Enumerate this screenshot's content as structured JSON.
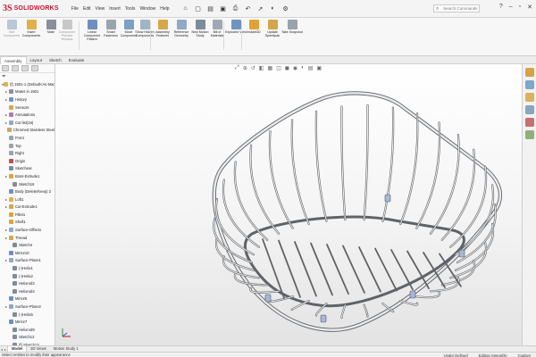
{
  "app": {
    "logo_mark": "3S",
    "logo_text": "SOLIDWORKS"
  },
  "menu": [
    "File",
    "Edit",
    "View",
    "Insert",
    "Tools",
    "Window",
    "Help"
  ],
  "quick_access": [
    {
      "icon": "home-icon",
      "glyph": "⌂"
    },
    {
      "icon": "new-document-icon",
      "glyph": "▢"
    },
    {
      "icon": "open-folder-icon",
      "glyph": "▤"
    },
    {
      "icon": "save-icon",
      "glyph": "▣"
    },
    {
      "icon": "print-icon",
      "glyph": "⎙"
    },
    {
      "icon": "undo-icon",
      "glyph": "↶"
    },
    {
      "icon": "select-pointer-icon",
      "glyph": "➚"
    },
    {
      "icon": "rebuild-icon",
      "glyph": "◐"
    },
    {
      "icon": "options-gear-icon",
      "glyph": "⚙"
    }
  ],
  "search": {
    "placeholder": "Search Commands"
  },
  "ribbon": [
    {
      "label": "Edit Component",
      "color": "#b9c7d6",
      "dim": true
    },
    {
      "label": "Insert Components",
      "color": "#e2b04a",
      "dim": false
    },
    {
      "label": "Mate",
      "color": "#8a8f99",
      "dim": false
    },
    {
      "label": "Component Preview Window",
      "color": "#c8c8c8",
      "dim": true
    },
    {
      "label": "Linear Component Pattern",
      "color": "#6f8fbf",
      "dim": false
    },
    {
      "label": "Smart Fasteners",
      "color": "#9aa4ad",
      "dim": false
    },
    {
      "label": "Move Component",
      "color": "#7c9fc4",
      "dim": false
    },
    {
      "label": "Show Hidden Components",
      "color": "#a0b4c6",
      "dim": false
    },
    {
      "label": "Assembly Features",
      "color": "#d7a64c",
      "dim": false
    },
    {
      "label": "Reference Geometry",
      "color": "#8fa9c7",
      "dim": false
    },
    {
      "label": "New Motion Study",
      "color": "#7f8c99",
      "dim": false
    },
    {
      "label": "Bill of Materials",
      "color": "#9fa9b3",
      "dim": false
    },
    {
      "label": "Exploded View",
      "color": "#6f96c3",
      "dim": false
    },
    {
      "label": "Instant3D",
      "color": "#e0a236",
      "dim": false
    },
    {
      "label": "Update Speedpak",
      "color": "#d3a64a",
      "dim": false
    },
    {
      "label": "Take Snapshot",
      "color": "#9aa3ab",
      "dim": false
    }
  ],
  "cm_tabs": [
    "Assembly",
    "Layout",
    "Sketch",
    "Evaluate"
  ],
  "left_panel": {
    "filter_icon": "filter-icon",
    "tree": [
      {
        "label": "(f) 1501-1 (Default<As Machined>)",
        "indent": 0,
        "icon_color": "#e2b04a",
        "arrow": "▾"
      },
      {
        "label": "Mates in 1501",
        "indent": 1,
        "icon_color": "#8a8f99",
        "arrow": "▸"
      },
      {
        "label": "History",
        "indent": 1,
        "icon_color": "#6f96c3",
        "arrow": "▸"
      },
      {
        "label": "Sensors",
        "indent": 1,
        "icon_color": "#d7a64c",
        "arrow": ""
      },
      {
        "label": "Annotations",
        "indent": 1,
        "icon_color": "#b07bb5",
        "arrow": "▸"
      },
      {
        "label": "Cut list(18)",
        "indent": 1,
        "icon_color": "#8fa9c7",
        "arrow": "▸"
      },
      {
        "label": "Chromed Stainless Steel",
        "indent": 1,
        "icon_color": "#c9a66b",
        "arrow": ""
      },
      {
        "label": "Front",
        "indent": 1,
        "icon_color": "#9aa3ab",
        "arrow": ""
      },
      {
        "label": "Top",
        "indent": 1,
        "icon_color": "#9aa3ab",
        "arrow": ""
      },
      {
        "label": "Right",
        "indent": 1,
        "icon_color": "#9aa3ab",
        "arrow": ""
      },
      {
        "label": "Origin",
        "indent": 1,
        "icon_color": "#c04f4f",
        "arrow": ""
      },
      {
        "label": "Sketchear",
        "indent": 1,
        "icon_color": "#7f8c99",
        "arrow": ""
      },
      {
        "label": "Boss-Extrude1",
        "indent": 1,
        "icon_color": "#e0a236",
        "arrow": "▸"
      },
      {
        "label": "Sketch16",
        "indent": 2,
        "icon_color": "#7f8c99",
        "arrow": ""
      },
      {
        "label": "Body (Delete/Keep) 2",
        "indent": 1,
        "icon_color": "#6f8fbf",
        "arrow": ""
      },
      {
        "label": "Loft1",
        "indent": 1,
        "icon_color": "#e2b04a",
        "arrow": "▸"
      },
      {
        "label": "Cut-Extrude1",
        "indent": 1,
        "icon_color": "#d7a64c",
        "arrow": "▸"
      },
      {
        "label": "Fillet1",
        "indent": 1,
        "icon_color": "#e0a236",
        "arrow": ""
      },
      {
        "label": "Shell1",
        "indent": 1,
        "icon_color": "#e0a236",
        "arrow": ""
      },
      {
        "label": "Surface-Offset1",
        "indent": 1,
        "icon_color": "#8fa9c7",
        "arrow": "▸"
      },
      {
        "label": "Thread",
        "indent": 1,
        "icon_color": "#d7a64c",
        "arrow": "▸"
      },
      {
        "label": "Sketch4",
        "indent": 2,
        "icon_color": "#7f8c99",
        "arrow": ""
      },
      {
        "label": "Mirror10",
        "indent": 1,
        "icon_color": "#6f8fbf",
        "arrow": ""
      },
      {
        "label": "Surface-Plane1",
        "indent": 1,
        "icon_color": "#8fa9c7",
        "arrow": "▸"
      },
      {
        "label": "(-)Helix1",
        "indent": 2,
        "icon_color": "#7f8c99",
        "arrow": ""
      },
      {
        "label": "(-)Helix2",
        "indent": 2,
        "icon_color": "#7f8c99",
        "arrow": ""
      },
      {
        "label": "Helixrod3",
        "indent": 2,
        "icon_color": "#7f8c99",
        "arrow": ""
      },
      {
        "label": "Helixrod4",
        "indent": 2,
        "icon_color": "#7f8c99",
        "arrow": ""
      },
      {
        "label": "Mirror5",
        "indent": 1,
        "icon_color": "#6f8fbf",
        "arrow": ""
      },
      {
        "label": "Surface-Plane2",
        "indent": 1,
        "icon_color": "#8fa9c7",
        "arrow": "▸"
      },
      {
        "label": "(-)Helix5",
        "indent": 2,
        "icon_color": "#7f8c99",
        "arrow": ""
      },
      {
        "label": "Mirror7",
        "indent": 1,
        "icon_color": "#6f8fbf",
        "arrow": ""
      },
      {
        "label": "Helixrod9",
        "indent": 2,
        "icon_color": "#7f8c99",
        "arrow": ""
      },
      {
        "label": "Sketch12",
        "indent": 2,
        "icon_color": "#7f8c99",
        "arrow": ""
      },
      {
        "label": "(f) Sketch13",
        "indent": 2,
        "icon_color": "#7f8c99",
        "arrow": ""
      }
    ]
  },
  "hud": [
    {
      "icon": "zoom-to-fit-icon",
      "glyph": "⤢"
    },
    {
      "icon": "zoom-area-icon",
      "glyph": "⊕"
    },
    {
      "icon": "previous-view-icon",
      "glyph": "↺"
    },
    {
      "icon": "section-view-icon",
      "glyph": "◧"
    },
    {
      "icon": "dynamic-annotation-icon",
      "glyph": "▦"
    },
    {
      "icon": "view-orientation-icon",
      "glyph": "◫"
    },
    {
      "icon": "display-style-icon",
      "glyph": "◼"
    },
    {
      "icon": "hide-show-items-icon",
      "glyph": "◉"
    },
    {
      "icon": "edit-appearance-icon",
      "glyph": "◐"
    },
    {
      "icon": "apply-scene-icon",
      "glyph": "▤"
    },
    {
      "icon": "view-settings-icon",
      "glyph": "▣"
    }
  ],
  "task_pane": [
    {
      "icon": "solidworks-resources-icon",
      "color": "#d6a24a"
    },
    {
      "icon": "design-library-icon",
      "color": "#7fa7c9"
    },
    {
      "icon": "file-explorer-icon",
      "color": "#d9b35a"
    },
    {
      "icon": "view-palette-icon",
      "color": "#8aa5bf"
    },
    {
      "icon": "appearances-icon",
      "color": "#c96f6f"
    },
    {
      "icon": "custom-properties-icon",
      "color": "#8fb07b"
    }
  ],
  "bottom_tabs": [
    "Model",
    "3D Views",
    "Motion Study 1"
  ],
  "status": {
    "message": "Select entities to modify their appearance",
    "right": [
      "Under Defined",
      "Editing Assembly",
      "Custom"
    ]
  },
  "colors": {
    "wire": "#b8bcc1",
    "wire_dark": "#5f6368",
    "foot": "#a9b7d6",
    "accent": "#c8102e"
  }
}
